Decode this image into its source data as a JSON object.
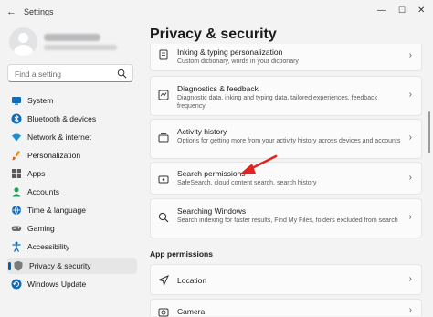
{
  "window": {
    "title": "Settings",
    "back_glyph": "←",
    "min_glyph": "—",
    "max_glyph": "☐",
    "close_glyph": "✕"
  },
  "search": {
    "placeholder": "Find a setting"
  },
  "sidebar": {
    "items": [
      {
        "label": "System",
        "icon": "system-icon",
        "color": "#0f6cbd"
      },
      {
        "label": "Bluetooth & devices",
        "icon": "bluetooth-icon",
        "color": "#0f6cbd"
      },
      {
        "label": "Network & internet",
        "icon": "wifi-icon",
        "color": "#1b8fd8"
      },
      {
        "label": "Personalization",
        "icon": "brush-icon",
        "color": "#e08a2a"
      },
      {
        "label": "Apps",
        "icon": "apps-icon",
        "color": "#5a5a5a"
      },
      {
        "label": "Accounts",
        "icon": "accounts-icon",
        "color": "#22a35a"
      },
      {
        "label": "Time & language",
        "icon": "globe-clock-icon",
        "color": "#0f6cbd"
      },
      {
        "label": "Gaming",
        "icon": "gamepad-icon",
        "color": "#6b6b6b"
      },
      {
        "label": "Accessibility",
        "icon": "accessibility-icon",
        "color": "#0f6cbd"
      },
      {
        "label": "Privacy & security",
        "icon": "shield-icon",
        "color": "#7a7a7a",
        "active": true
      },
      {
        "label": "Windows Update",
        "icon": "update-icon",
        "color": "#0f6cbd"
      }
    ]
  },
  "main": {
    "title": "Privacy & security",
    "cards": [
      {
        "title": "Inking & typing personalization",
        "desc": "Custom dictionary, words in your dictionary",
        "icon": "notebook-icon"
      },
      {
        "title": "Diagnostics & feedback",
        "desc": "Diagnostic data, inking and typing data, tailored experiences, feedback frequency",
        "icon": "diagnostics-icon"
      },
      {
        "title": "Activity history",
        "desc": "Options for getting more from your activity history across devices and accounts",
        "icon": "activity-history-icon"
      },
      {
        "title": "Search permissions",
        "desc": "SafeSearch, cloud content search, search history",
        "icon": "search-permissions-icon"
      },
      {
        "title": "Searching Windows",
        "desc": "Search indexing for faster results, Find My Files, folders excluded from search",
        "icon": "search-icon"
      }
    ],
    "section_app_permissions": "App permissions",
    "app_permissions": [
      {
        "title": "Location",
        "icon": "location-icon"
      },
      {
        "title": "Camera",
        "icon": "camera-icon"
      }
    ],
    "chevron": "›"
  },
  "colors": {
    "accent": "#005fb8",
    "annotation_arrow": "#e02424"
  }
}
